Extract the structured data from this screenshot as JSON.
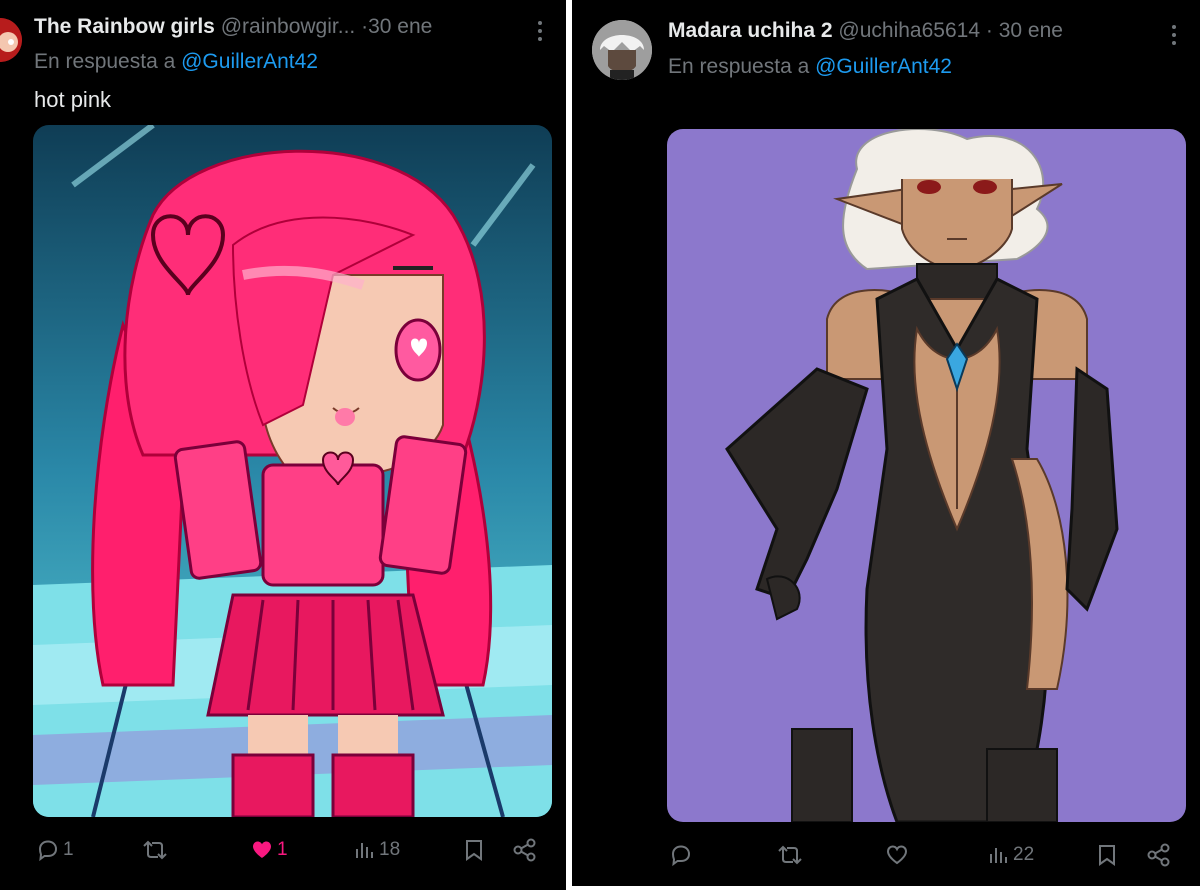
{
  "tweets": [
    {
      "display_name": "The Rainbow girls",
      "handle": "@rainbowgir...",
      "separator": "·",
      "date": "30 ene",
      "reply_prefix": "En respuesta a",
      "reply_to": "@GuillerAnt42",
      "text": "hot pink",
      "actions": {
        "replies": "1",
        "retweets": "",
        "likes": "1",
        "views": "18"
      },
      "liked": true,
      "icons": [
        "more-icon",
        "reply-icon",
        "retweet-icon",
        "like-icon",
        "views-icon",
        "bookmark-icon",
        "share-icon"
      ]
    },
    {
      "display_name": "Madara uchiha 2",
      "handle": "@uchiha65614",
      "separator": "·",
      "date": "30 ene",
      "reply_prefix": "En respuesta a",
      "reply_to": "@GuillerAnt42",
      "text": "",
      "actions": {
        "replies": "",
        "retweets": "",
        "likes": "",
        "views": "22"
      },
      "liked": false,
      "icons": [
        "more-icon",
        "reply-icon",
        "retweet-icon",
        "like-icon",
        "views-icon",
        "bookmark-icon",
        "share-icon"
      ]
    }
  ],
  "colors": {
    "background": "#000000",
    "name": "#e7e9ea",
    "secondary": "#71767b",
    "link": "#1d9bf0",
    "like": "#f91880",
    "media_left_bg": "#1e6f8a",
    "media_right_bg": "#8c78cc"
  }
}
